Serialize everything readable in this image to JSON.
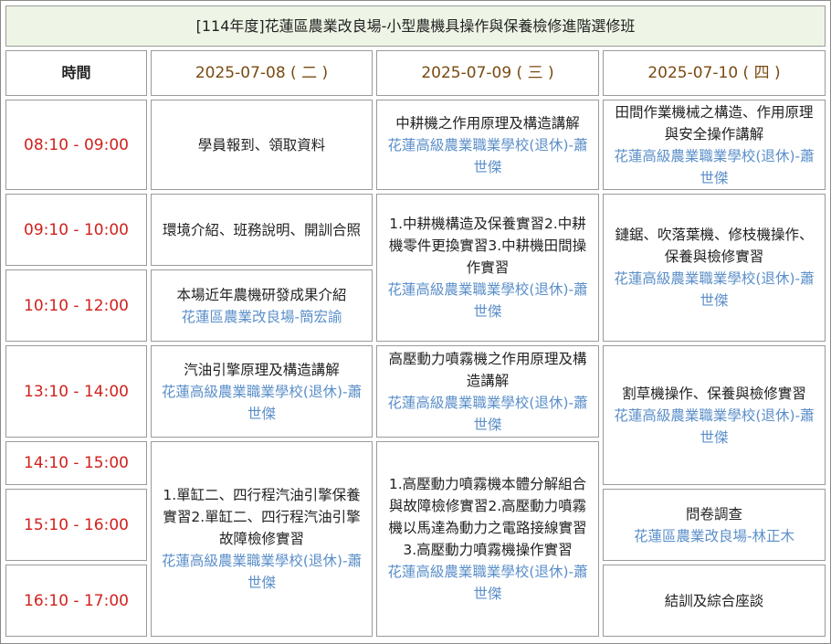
{
  "title": "[114年度]花蓮區農業改良場-小型農機具操作與保養檢修進階選修班",
  "header": {
    "time_label": "時間",
    "days": [
      "2025-07-08 ( 二 )",
      "2025-07-09 ( 三 )",
      "2025-07-10 ( 四 )"
    ]
  },
  "times": [
    "08:10 - 09:00",
    "09:10 - 10:00",
    "10:10 - 12:00",
    "13:10 - 14:00",
    "14:10 - 15:00",
    "15:10 - 16:00",
    "16:10 - 17:00"
  ],
  "day1": {
    "s1": {
      "topic": "學員報到、領取資料"
    },
    "s2": {
      "topic": "環境介紹、班務說明、開訓合照"
    },
    "s3": {
      "topic": "本場近年農機研發成果介紹",
      "instructor": "花蓮區農業改良場-簡宏諭"
    },
    "s4": {
      "topic": "汽油引擎原理及構造講解",
      "instructor": "花蓮高級農業職業學校(退休)-蕭世傑"
    },
    "s5": {
      "topic": "1.單缸二、四行程汽油引擎保養實習2.單缸二、四行程汽油引擎故障檢修實習",
      "instructor": "花蓮高級農業職業學校(退休)-蕭世傑"
    }
  },
  "day2": {
    "s1": {
      "topic": "中耕機之作用原理及構造講解",
      "instructor": "花蓮高級農業職業學校(退休)-蕭世傑"
    },
    "s2": {
      "topic": "1.中耕機構造及保養實習2.中耕機零件更換實習3.中耕機田間操作實習",
      "instructor": "花蓮高級農業職業學校(退休)-蕭世傑"
    },
    "s3": {
      "topic": "高壓動力噴霧機之作用原理及構造講解",
      "instructor": "花蓮高級農業職業學校(退休)-蕭世傑"
    },
    "s4": {
      "topic": "1.高壓動力噴霧機本體分解組合與故障檢修實習2.高壓動力噴霧機以馬達為動力之電路接線實習3.高壓動力噴霧機操作實習",
      "instructor": "花蓮高級農業職業學校(退休)-蕭世傑"
    }
  },
  "day3": {
    "s1": {
      "topic": "田間作業機械之構造、作用原理與安全操作講解",
      "instructor": "花蓮高級農業職業學校(退休)-蕭世傑"
    },
    "s2": {
      "topic": "鏈鋸、吹落葉機、修枝機操作、保養與檢修實習",
      "instructor": "花蓮高級農業職業學校(退休)-蕭世傑"
    },
    "s3": {
      "topic": "割草機操作、保養與檢修實習",
      "instructor": "花蓮高級農業職業學校(退休)-蕭世傑"
    },
    "s4": {
      "topic": "問卷調查",
      "instructor": "花蓮區農業改良場-林正木"
    },
    "s5": {
      "topic": "結訓及綜合座談"
    }
  }
}
